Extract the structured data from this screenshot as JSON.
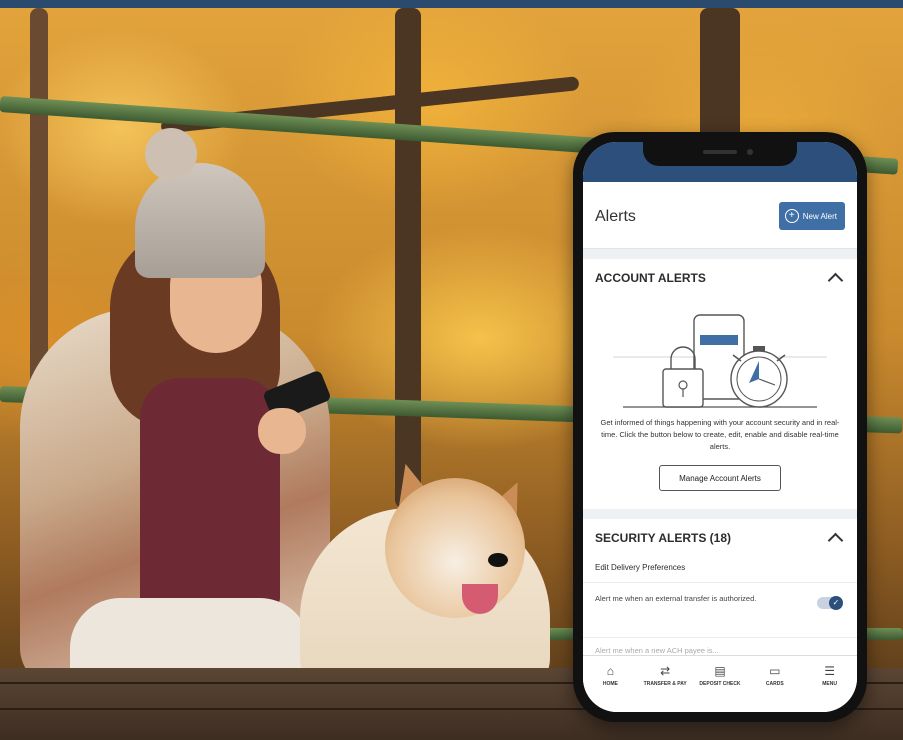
{
  "app": {
    "title": "Alerts",
    "new_alert_label": "New Alert",
    "accent_color": "#3f6fa5",
    "header_color": "#2d4f7c"
  },
  "account_alerts": {
    "title": "ACCOUNT ALERTS",
    "description": "Get informed of things happening with your account security and in real-time. Click the button below to create, edit, enable and disable real-time alerts.",
    "manage_button": "Manage Account Alerts"
  },
  "security_alerts": {
    "title": "SECURITY ALERTS (18)",
    "delivery_link": "Edit Delivery Preferences",
    "rows": [
      {
        "text": "Alert me when an external transfer is authorized.",
        "enabled": true
      }
    ],
    "faded_row": "Alert me when a new ACH payee is..."
  },
  "bottom_nav": [
    {
      "icon": "home-icon",
      "glyph": "⌂",
      "label": "HOME"
    },
    {
      "icon": "transfer-icon",
      "glyph": "⇄",
      "label": "TRANSFER & PAY"
    },
    {
      "icon": "deposit-icon",
      "glyph": "▤",
      "label": "DEPOSIT CHECK"
    },
    {
      "icon": "cards-icon",
      "glyph": "▭",
      "label": "CARDS"
    },
    {
      "icon": "menu-icon",
      "glyph": "☰",
      "label": "MENU"
    }
  ]
}
